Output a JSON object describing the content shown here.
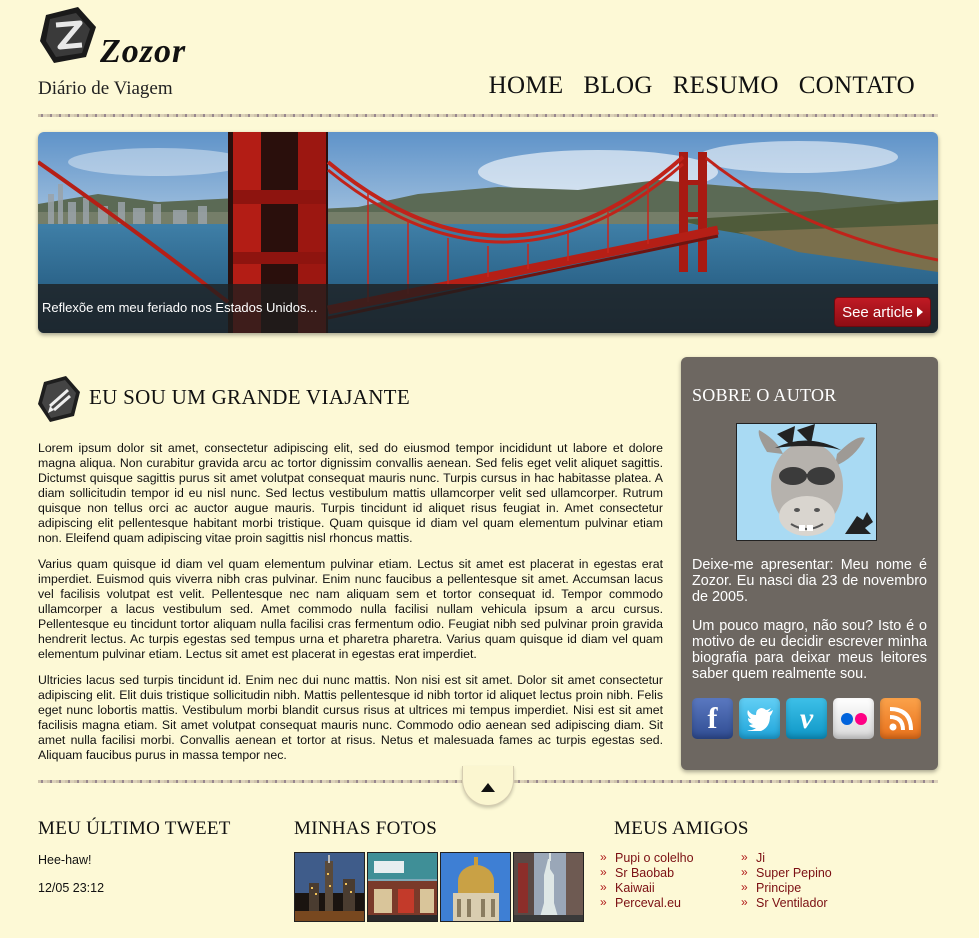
{
  "header": {
    "brand": "Zozor",
    "tagline": "Diário de Viagem",
    "nav": [
      {
        "label": "HOME"
      },
      {
        "label": "BLOG"
      },
      {
        "label": "RESUMO"
      },
      {
        "label": "CONTATO"
      }
    ]
  },
  "hero": {
    "caption": "Reflexõe em meu feriado nos Estados Unidos...",
    "button_label": "See article"
  },
  "post": {
    "title": "EU SOU UM GRANDE VIAJANTE",
    "paragraphs": [
      "Lorem ipsum dolor sit amet, consectetur adipiscing elit, sed do eiusmod tempor incididunt ut labore et dolore magna aliqua. Non curabitur gravida arcu ac tortor dignissim convallis aenean. Sed felis eget velit aliquet sagittis. Dictumst quisque sagittis purus sit amet volutpat consequat mauris nunc. Turpis cursus in hac habitasse platea. A diam sollicitudin tempor id eu nisl nunc. Sed lectus vestibulum mattis ullamcorper velit sed ullamcorper. Rutrum quisque non tellus orci ac auctor augue mauris. Turpis tincidunt id aliquet risus feugiat in. Amet consectetur adipiscing elit pellentesque habitant morbi tristique. Quam quisque id diam vel quam elementum pulvinar etiam non. Eleifend quam adipiscing vitae proin sagittis nisl rhoncus mattis.",
      "Varius quam quisque id diam vel quam elementum pulvinar etiam. Lectus sit amet est placerat in egestas erat imperdiet. Euismod quis viverra nibh cras pulvinar. Enim nunc faucibus a pellentesque sit amet. Accumsan lacus vel facilisis volutpat est velit. Pellentesque nec nam aliquam sem et tortor consequat id. Tempor commodo ullamcorper a lacus vestibulum sed. Amet commodo nulla facilisi nullam vehicula ipsum a arcu cursus. Pellentesque eu tincidunt tortor aliquam nulla facilisi cras fermentum odio. Feugiat nibh sed pulvinar proin gravida hendrerit lectus. Ac turpis egestas sed tempus urna et pharetra pharetra. Varius quam quisque id diam vel quam elementum pulvinar etiam. Lectus sit amet est placerat in egestas erat imperdiet.",
      "Ultricies lacus sed turpis tincidunt id. Enim nec dui nunc mattis. Non nisi est sit amet. Dolor sit amet consectetur adipiscing elit. Elit duis tristique sollicitudin nibh. Mattis pellentesque id nibh tortor id aliquet lectus proin nibh. Felis eget nunc lobortis mattis. Vestibulum morbi blandit cursus risus at ultrices mi tempus imperdiet. Nisi est sit amet facilisis magna etiam. Sit amet volutpat consequat mauris nunc. Commodo odio aenean sed adipiscing diam. Sit amet nulla facilisi morbi. Convallis aenean et tortor at risus. Netus et malesuada fames ac turpis egestas sed. Aliquam faucibus purus in massa tempor nec."
    ]
  },
  "sidebar": {
    "title": "SOBRE O AUTOR",
    "bio": [
      "Deixe-me apresentar: Meu nome é Zozor. Eu nasci dia 23 de novembro de 2005.",
      "Um pouco magro, não sou? Isto é o motivo de eu decidir escrever minha biografia para deixar meus leitores saber quem realmente sou."
    ],
    "socials": [
      {
        "name": "facebook-icon",
        "glyph": "f"
      },
      {
        "name": "twitter-icon",
        "glyph": ""
      },
      {
        "name": "vimeo-icon",
        "glyph": "v"
      },
      {
        "name": "flickr-icon",
        "glyph": ""
      },
      {
        "name": "rss-icon",
        "glyph": ""
      }
    ]
  },
  "footer": {
    "tweet": {
      "title": "MEU ÚLTIMO TWEET",
      "text": "Hee-haw!",
      "time": "12/05 23:12"
    },
    "photos": {
      "title": "MINHAS FOTOS"
    },
    "friends": {
      "title": "MEUS AMIGOS",
      "col1": [
        "Pupi o colelho",
        "Sr Baobab",
        "Kaiwaii",
        "Perceval.eu"
      ],
      "col2": [
        "Ji",
        "Super Pepino",
        "Principe",
        "Sr Ventilador"
      ]
    }
  },
  "colors": {
    "background": "#fdf9d6",
    "sidebar": "#6d6761",
    "accent_red": "#b0141d",
    "link": "#7b0f13"
  }
}
